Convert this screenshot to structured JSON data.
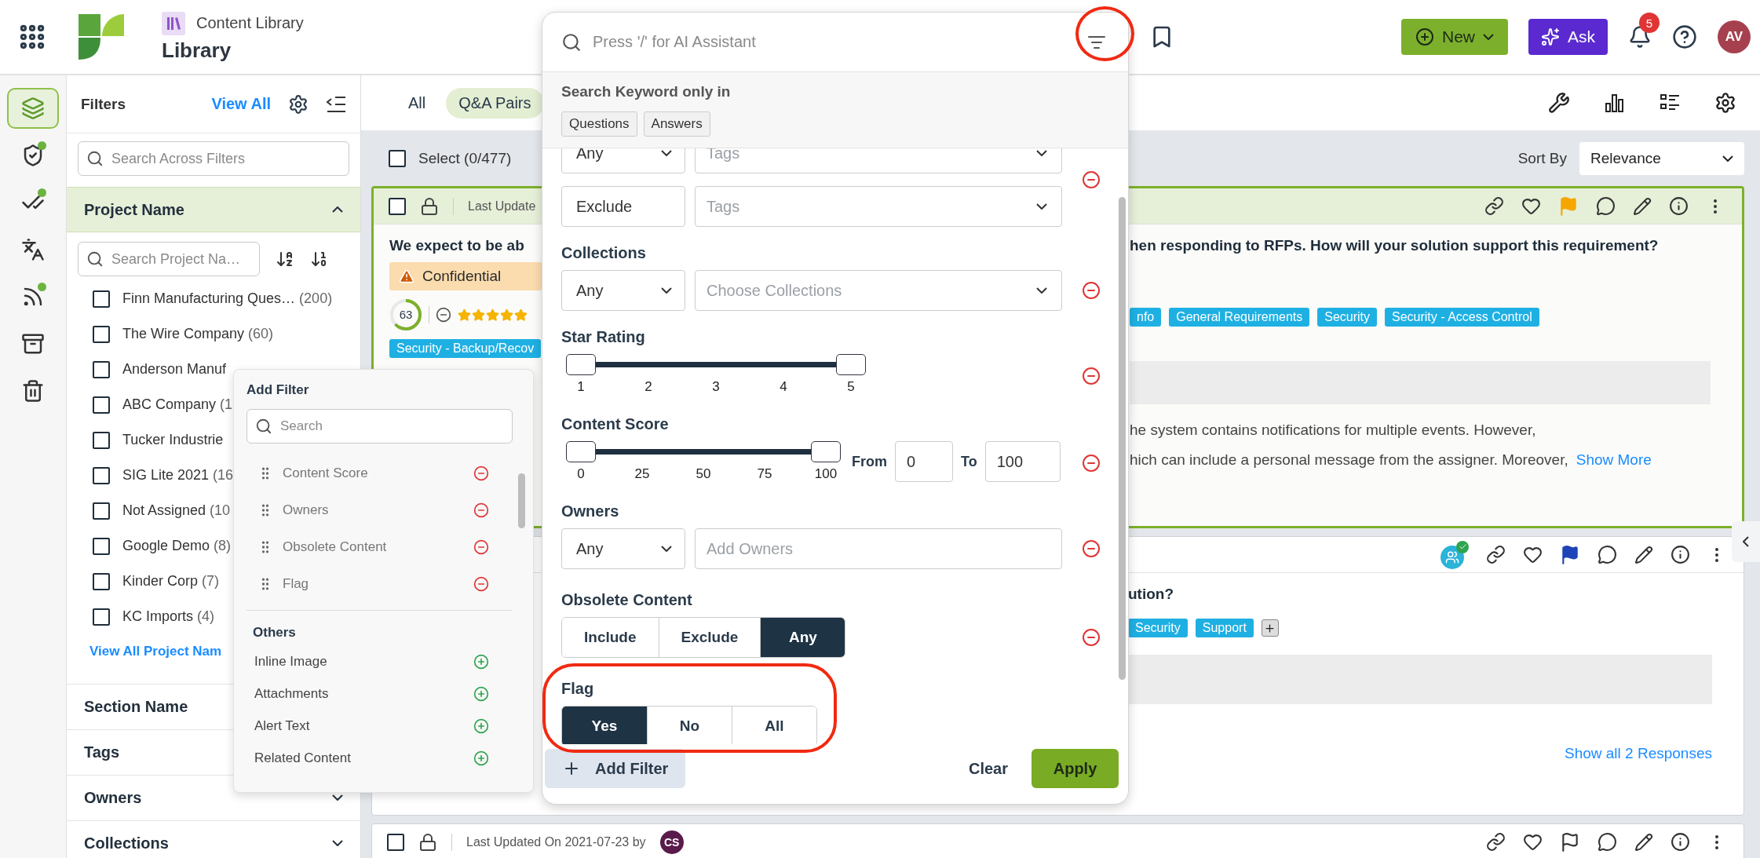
{
  "header": {
    "app_label": "Content Library",
    "title": "Library",
    "new_label": "New",
    "ask_label": "Ask",
    "notification_count": "5",
    "avatar": "AV"
  },
  "rail": [
    {
      "kind": "layers",
      "selected": true,
      "dot": false
    },
    {
      "kind": "shield",
      "selected": false,
      "dot": true
    },
    {
      "kind": "checks",
      "selected": false,
      "dot": true
    },
    {
      "kind": "translate",
      "selected": false,
      "dot": false
    },
    {
      "kind": "rss",
      "selected": false,
      "dot": true
    },
    {
      "kind": "archive",
      "selected": false,
      "dot": false
    },
    {
      "kind": "trash",
      "selected": false,
      "dot": false
    }
  ],
  "filters_panel": {
    "title": "Filters",
    "view_all": "View All",
    "search_placeholder": "Search Across Filters",
    "sections": [
      {
        "title": "Project Name",
        "expanded": true,
        "search_placeholder": "Search Project Na…",
        "items": [
          {
            "label": "Finn Manufacturing Ques…",
            "count": "(200)",
            "checked": false
          },
          {
            "label": "The Wire Company",
            "count": "(60)",
            "checked": false
          },
          {
            "label": "Anderson Manuf",
            "checked": false
          },
          {
            "label": "ABC Company",
            "count": "(1",
            "checked": false
          },
          {
            "label": "Tucker Industrie",
            "checked": false
          },
          {
            "label": "SIG Lite 2021",
            "count": "(16",
            "checked": false
          },
          {
            "label": "Not Assigned",
            "count": "(10",
            "checked": false
          },
          {
            "label": "Google Demo",
            "count": "(8)",
            "checked": false
          },
          {
            "label": "Kinder Corp",
            "count": "(7)",
            "checked": false
          },
          {
            "label": "KC Imports",
            "count": "(4)",
            "checked": false
          }
        ],
        "view_all": "View All Project Nam"
      },
      {
        "title": "Section Name"
      },
      {
        "title": "Tags"
      },
      {
        "title": "Owners",
        "expanded": false
      },
      {
        "title": "Collections",
        "expanded": false
      }
    ]
  },
  "main": {
    "tabs": [
      {
        "label": "All",
        "selected": false
      },
      {
        "label": "Q&A Pairs",
        "selected": true
      }
    ],
    "select_all_checked": false,
    "select_label": "Select (0/477)",
    "sort_label": "Sort By",
    "sort_value": "Relevance"
  },
  "cards": [
    {
      "selected": true,
      "checked": false,
      "updated": "Last Update",
      "question_start": "We expect to be ab",
      "question_end": "hen responding to RFPs. How will your solution support this requirement?",
      "badge": "Confidential",
      "score": "63",
      "stars": 5,
      "left_tags": [
        "Security - Backup/Recov"
      ],
      "right_tags": [
        "nfo",
        "General Requirements",
        "Security",
        "Security - Access Control"
      ],
      "answer_lines": [
        "he system contains notifications for multiple events. However,",
        "hich can include a personal message from the assigner. Moreover,"
      ],
      "show_more": "Show More",
      "flagged": true,
      "color": "#f7a600"
    },
    {
      "selected": false,
      "assigned": true,
      "question_end": "ution?",
      "right_tags": [
        "Security",
        "Support"
      ],
      "show_responses": "Show all 2 Responses",
      "flagged": true,
      "color": "#1f44b8"
    },
    {
      "selected": false,
      "checked": false,
      "updated": "Last Updated On 2021-07-23 by",
      "author": "CS",
      "flagged": false
    }
  ],
  "popup": {
    "search_placeholder": "Press '/' for AI Assistant",
    "keyword_title": "Search Keyword only in",
    "keyword_chips": [
      {
        "label": "Questions",
        "selected": false
      },
      {
        "label": "Answers",
        "selected": false
      }
    ],
    "groups": [
      {
        "kind": "select",
        "rows": [
          {
            "mode": "Any",
            "mode_caret": true,
            "placeholder": "Tags",
            "caret": true
          },
          {
            "mode": "Exclude",
            "mode_caret": false,
            "placeholder": "Tags",
            "caret": true
          }
        ]
      },
      {
        "kind": "select",
        "title": "Collections",
        "rows": [
          {
            "mode": "Any",
            "mode_caret": true,
            "placeholder": "Choose Collections",
            "caret": true
          }
        ]
      },
      {
        "kind": "range",
        "title": "Star Rating",
        "thumbs": [
          {
            "level": 0
          },
          {
            "level": 1
          }
        ],
        "ticks": [
          "1",
          "2",
          "3",
          "4",
          "5"
        ]
      },
      {
        "kind": "range",
        "title": "Content Score",
        "thumbs": [
          {
            "level": 0
          },
          {
            "level": 1
          }
        ],
        "ticks": [
          "0",
          "25",
          "50",
          "75",
          "100"
        ],
        "from_label": "From",
        "from": "0",
        "to_label": "To",
        "to": "100"
      },
      {
        "kind": "select",
        "title": "Owners",
        "rows": [
          {
            "mode": "Any",
            "mode_caret": true,
            "placeholder": "Add Owners",
            "caret": false
          }
        ]
      },
      {
        "kind": "segmented",
        "title": "Obsolete Content",
        "removable": true,
        "options": [
          {
            "label": "Include",
            "selected": false
          },
          {
            "label": "Exclude",
            "selected": false
          },
          {
            "label": "Any",
            "selected": true
          }
        ]
      },
      {
        "kind": "segmented",
        "title": "Flag",
        "removable": false,
        "options": [
          {
            "label": "Yes",
            "selected": true
          },
          {
            "label": "No",
            "selected": false
          },
          {
            "label": "All",
            "selected": false
          }
        ]
      }
    ],
    "add_filter": "Add Filter",
    "clear": "Clear",
    "apply": "Apply"
  },
  "add_filter": {
    "title": "Add Filter",
    "search_placeholder": "Search",
    "active": [
      "Content Score",
      "Owners",
      "Obsolete Content",
      "Flag"
    ],
    "others_title": "Others",
    "others": [
      "Inline Image",
      "Attachments",
      "Alert Text",
      "Related Content"
    ]
  }
}
